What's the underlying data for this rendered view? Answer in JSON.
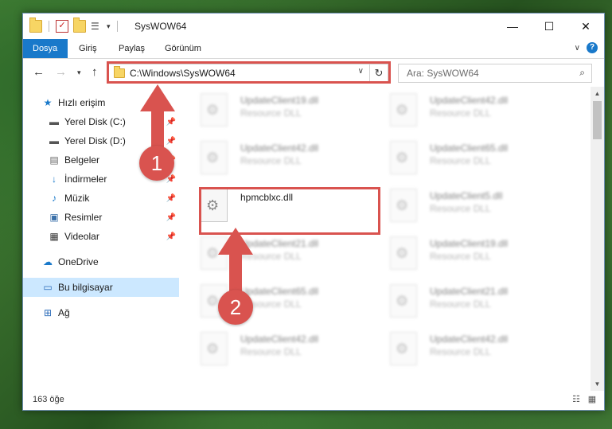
{
  "window": {
    "title": "SysWOW64",
    "controls": [
      "minimize-icon",
      "maximize-icon",
      "close-icon"
    ]
  },
  "ribbon": {
    "tabs": [
      "Dosya",
      "Giriş",
      "Paylaş",
      "Görünüm"
    ]
  },
  "navbar": {
    "address": "C:\\Windows\\SysWOW64",
    "search_placeholder": "Ara: SysWOW64"
  },
  "sidebar": {
    "items": [
      {
        "label": "Hızlı erişim",
        "icon": "star-icon"
      },
      {
        "label": "Yerel Disk (C:)",
        "icon": "drive-icon",
        "pinned": true
      },
      {
        "label": "Yerel Disk (D:)",
        "icon": "drive-icon",
        "pinned": true
      },
      {
        "label": "Belgeler",
        "icon": "documents-icon",
        "pinned": true
      },
      {
        "label": "İndirmeler",
        "icon": "download-icon",
        "pinned": true
      },
      {
        "label": "Müzik",
        "icon": "music-icon",
        "pinned": true
      },
      {
        "label": "Resimler",
        "icon": "pictures-icon",
        "pinned": true
      },
      {
        "label": "Videolar",
        "icon": "videos-icon",
        "pinned": true
      },
      {
        "label": "OneDrive",
        "icon": "cloud-icon"
      },
      {
        "label": "Bu bilgisayar",
        "icon": "computer-icon"
      },
      {
        "label": "Ağ",
        "icon": "network-icon"
      }
    ]
  },
  "files": [
    {
      "name": "UpdateClient19.dll",
      "type": "Resource DLL"
    },
    {
      "name": "UpdateClient42.dll",
      "type": "Resource DLL"
    },
    {
      "name": "UpdateClient42.dll",
      "type": "Resource DLL"
    },
    {
      "name": "UpdateClient65.dll",
      "type": "Resource DLL"
    },
    {
      "name": "hpmcblxc.dll",
      "type": ""
    },
    {
      "name": "UpdateClient5.dll",
      "type": "Resource DLL"
    },
    {
      "name": "UpdateClient21.dll",
      "type": "Resource DLL"
    },
    {
      "name": "UpdateClient19.dll",
      "type": "Resource DLL"
    },
    {
      "name": "UpdateClient65.dll",
      "type": "Resource DLL"
    },
    {
      "name": "UpdateClient21.dll",
      "type": "Resource DLL"
    },
    {
      "name": "UpdateClient42.dll",
      "type": "Resource DLL"
    },
    {
      "name": "UpdateClient42.dll",
      "type": "Resource DLL"
    }
  ],
  "status": {
    "count": "163 öğe"
  },
  "annotations": {
    "badge1": "1",
    "badge2": "2",
    "color": "#d9534f"
  }
}
